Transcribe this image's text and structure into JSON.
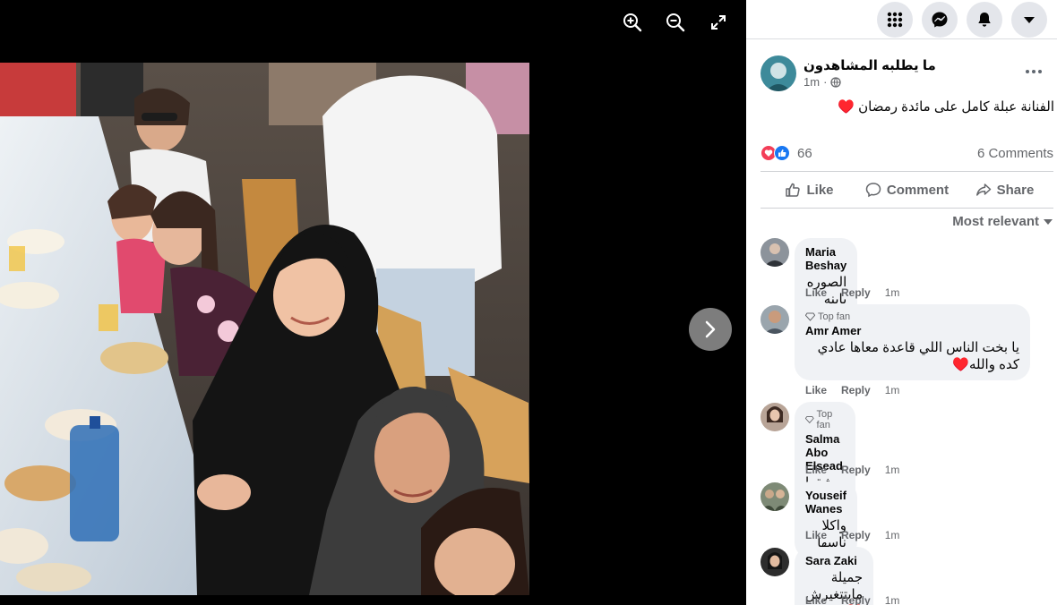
{
  "viewer": {
    "tools": [
      {
        "icon": "zoom-in-icon"
      },
      {
        "icon": "zoom-out-icon"
      },
      {
        "icon": "fullscreen-icon"
      }
    ],
    "next_icon": "chevron-right-icon"
  },
  "topbar": {
    "buttons": [
      {
        "icon": "menu-grid-icon"
      },
      {
        "icon": "messenger-icon"
      },
      {
        "icon": "notifications-bell-icon"
      },
      {
        "icon": "account-caret-icon"
      }
    ]
  },
  "post": {
    "page_name": "ما يطلبه المشاهدون",
    "time": "1m",
    "privacy_icon": "globe-icon",
    "caption": "الفنانة عبلة كامل على مائدة رمضان ♥️",
    "reactions_count": "66",
    "comments_count": "6 Comments",
    "actions": {
      "like": "Like",
      "comment": "Comment",
      "share": "Share"
    },
    "sort_label": "Most relevant"
  },
  "colors": {
    "brand_blue": "#1877f2",
    "love_red": "#f33e58",
    "secondary_text": "#65676b"
  },
  "comments": [
    {
      "name": "Maria Beshay",
      "badge": "",
      "text": "الصوره باينه متركبه اوى😂",
      "like": "Like",
      "reply": "Reply",
      "time": "1m"
    },
    {
      "name": "Amr Amer",
      "badge": "Top fan",
      "text": "يا بخت الناس اللي قاعدة معاها عادي كده والله♥️",
      "like": "Like",
      "reply": "Reply",
      "time": "1m"
    },
    {
      "name": "Salma Abo Elsead",
      "badge": "Top fan",
      "text": "بعشقها ♥️🌸",
      "like": "Like",
      "reply": "Reply",
      "time": "1m"
    },
    {
      "name": "Youseif Wanes",
      "badge": "",
      "text": "واكلا ناسها",
      "like": "Like",
      "reply": "Reply",
      "time": "1m"
    },
    {
      "name": "Sara Zaki",
      "badge": "",
      "text": "جميلة مابتتغيرش💔",
      "like": "Like",
      "reply": "Reply",
      "time": "1m"
    }
  ]
}
